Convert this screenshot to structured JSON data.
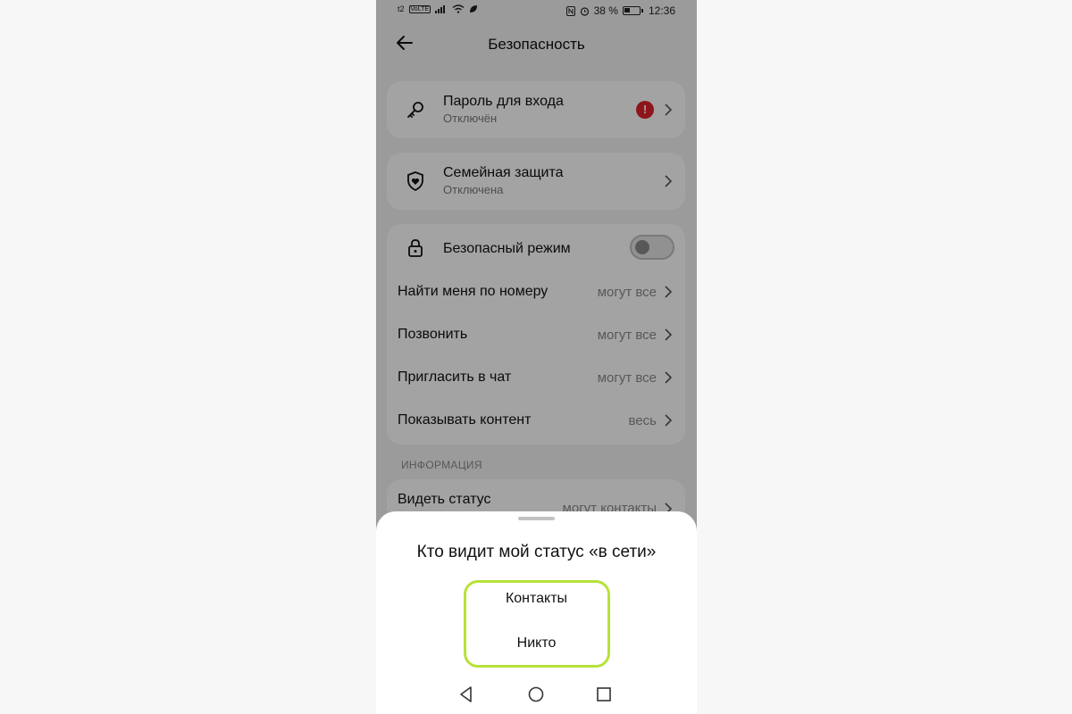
{
  "status_bar": {
    "carrier": "t2",
    "network": "VoLTE",
    "battery_percent": "38 %",
    "time": "12:36"
  },
  "header": {
    "title": "Безопасность",
    "back_icon": "arrow-left-icon"
  },
  "cards": {
    "login_password": {
      "title": "Пароль для входа",
      "subtitle": "Отключён",
      "alert": "!",
      "icon": "key-icon"
    },
    "family_protection": {
      "title": "Семейная защита",
      "subtitle": "Отключена",
      "icon": "shield-heart-icon"
    },
    "safe_mode": {
      "title": "Безопасный режим",
      "enabled": false,
      "icon": "lock-icon"
    }
  },
  "privacy_items": [
    {
      "label": "Найти меня по номеру",
      "value": "могут все"
    },
    {
      "label": "Позвонить",
      "value": "могут все"
    },
    {
      "label": "Пригласить в чат",
      "value": "могут все"
    },
    {
      "label": "Показывать контент",
      "value": "весь"
    }
  ],
  "info_section": {
    "label": "ИНФОРМАЦИЯ",
    "items": [
      {
        "label": "Видеть статус",
        "value": "могут контакты"
      }
    ]
  },
  "bottom_sheet": {
    "title": "Кто видит мой статус «в сети»",
    "options": [
      "Контакты",
      "Никто"
    ],
    "highlight_color": "#b6e23a"
  },
  "colors": {
    "alert": "#e0222d",
    "accent_outline": "#b6e23a"
  }
}
